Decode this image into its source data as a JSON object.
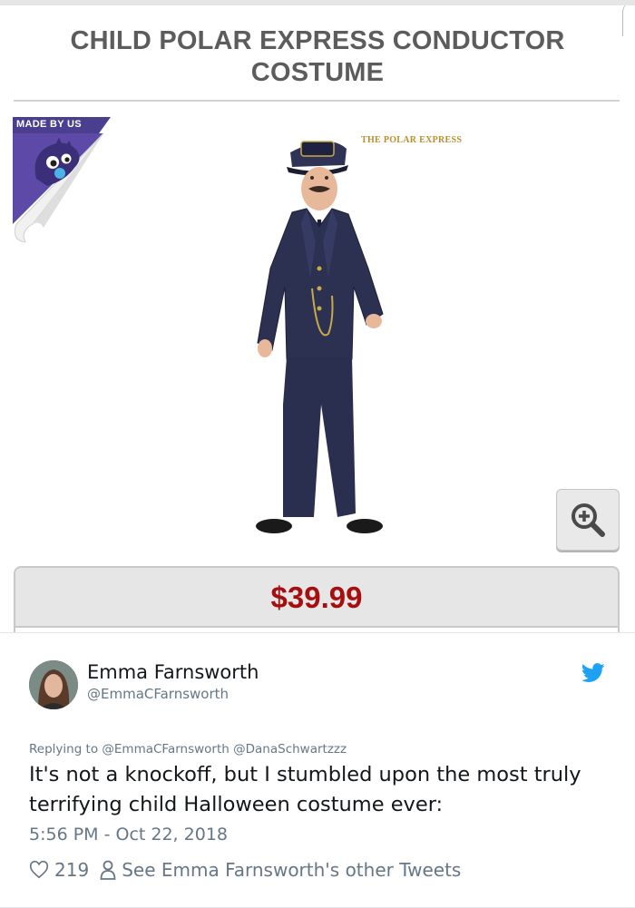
{
  "product": {
    "title": "CHILD POLAR EXPRESS CONDUCTOR COSTUME",
    "badge_text": "MADE BY US",
    "brand_logo": "THE POLAR EXPRESS",
    "price": "$39.99",
    "zoom_icon": "zoom-in-icon",
    "colors": {
      "price": "#a50f0f",
      "badge": "#4a3f8f",
      "title": "#5c5c5c"
    }
  },
  "tweet": {
    "author_name": "Emma Farnsworth",
    "author_handle": "@EmmaCFarnsworth",
    "reply_to": "Replying to @EmmaCFarnsworth @DanaSchwartzzz",
    "text": "It's not a knockoff, but I stumbled upon the most truly terrifying child Halloween costume ever:",
    "timestamp": "5:56 PM - Oct 22, 2018",
    "likes": "219",
    "other_tweets_link": "See Emma Farnsworth's other Tweets",
    "icons": [
      "twitter-bird-icon",
      "heart-icon",
      "person-icon"
    ],
    "colors": {
      "bird": "#1da1f2",
      "secondary": "#657786"
    }
  }
}
